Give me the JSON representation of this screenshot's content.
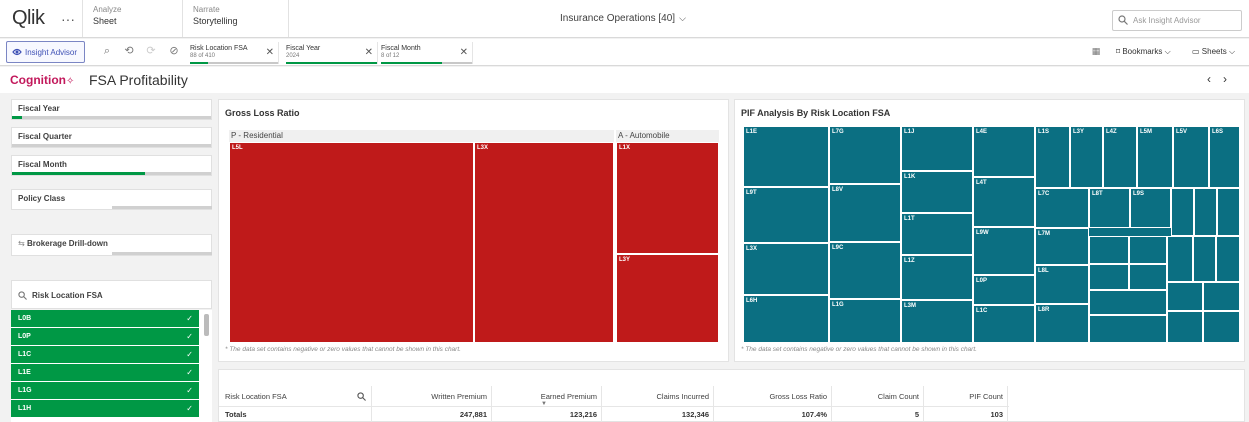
{
  "topnav": {
    "logo": "Qlik",
    "menu": "···",
    "tabs": [
      {
        "small": "Analyze",
        "big": "Sheet"
      },
      {
        "small": "Narrate",
        "big": "Storytelling"
      }
    ],
    "app_title": "Insurance Operations [40]",
    "ask_placeholder": "Ask Insight Advisor"
  },
  "toolbar": {
    "insight_label": "Insight Advisor",
    "chips": [
      {
        "label": "Risk Location FSA",
        "sub": "88 of 410",
        "fill": 0.21
      },
      {
        "label": "Fiscal Year",
        "sub": "2024",
        "fill": 1.0
      },
      {
        "label": "Fiscal Month",
        "sub": "8 of 12",
        "fill": 0.67
      }
    ],
    "bookmarks_label": "Bookmarks",
    "sheets_label": "Sheets"
  },
  "titlebar": {
    "brand": "Cognition",
    "title": "FSA Profitability"
  },
  "filters": [
    {
      "label": "Fiscal Year",
      "fill": 0.05
    },
    {
      "label": "Fiscal Quarter",
      "fill": 0
    },
    {
      "label": "Fiscal Month",
      "fill": 0.67
    },
    {
      "label": "Policy Class",
      "fill": 0
    },
    {
      "label": "Brokerage Drill-down",
      "fill": 0
    }
  ],
  "risk_location": {
    "label": "Risk Location FSA",
    "items": [
      "L0B",
      "L0P",
      "L1C",
      "L1E",
      "L1G",
      "L1H"
    ]
  },
  "gross_loss": {
    "title": "Gross Loss Ratio",
    "groups": [
      "P - Residential",
      "A - Automobile"
    ],
    "cells": [
      "L5L",
      "L3X",
      "L1X",
      "L3Y"
    ],
    "note": "* The data set contains negative or zero values that cannot be shown in this chart."
  },
  "pif": {
    "title": "PIF Analysis By Risk Location FSA",
    "cells": [
      "L1E",
      "L7G",
      "L1J",
      "L4E",
      "L1S",
      "L3Y",
      "L4Z",
      "L5M",
      "L5V",
      "L6S",
      "L1K",
      "L4T",
      "L9T",
      "L8V",
      "L7C",
      "L8T",
      "L9S",
      "L1T",
      "L9W",
      "L7M",
      "L3X",
      "L9C",
      "L1Z",
      "L8L",
      "L0P",
      "L6H",
      "L1G",
      "L3M",
      "L8R",
      "L1C"
    ],
    "note": "* The data set contains negative or zero values that cannot be shown in this chart."
  },
  "table": {
    "headers": [
      "Risk Location FSA",
      "Written Premium",
      "Earned Premium",
      "Claims Incurred",
      "Gross Loss Ratio",
      "Claim Count",
      "PIF Count"
    ],
    "totals": [
      "Totals",
      "247,881",
      "123,216",
      "132,346",
      "107.4%",
      "5",
      "103"
    ]
  }
}
